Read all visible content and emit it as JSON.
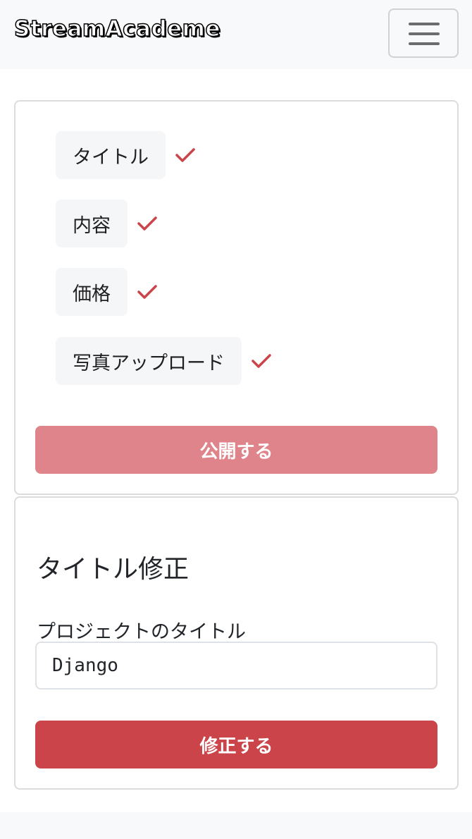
{
  "navbar": {
    "brand": "StreamAcademe",
    "toggler_icon": "hamburger-menu-icon"
  },
  "checklist": {
    "check_icon": "check-icon",
    "check_color": "#cb444a",
    "items": [
      {
        "label": "タイトル",
        "done": true
      },
      {
        "label": "内容",
        "done": true
      },
      {
        "label": "価格",
        "done": true
      },
      {
        "label": "写真アップロード",
        "done": true
      }
    ],
    "publish_label": "公開する",
    "publish_color": "#df848a"
  },
  "edit_form": {
    "heading": "タイトル修正",
    "field_label": "プロジェクトのタイトル",
    "field_value": "Django",
    "submit_label": "修正する",
    "submit_color": "#cb444a"
  }
}
